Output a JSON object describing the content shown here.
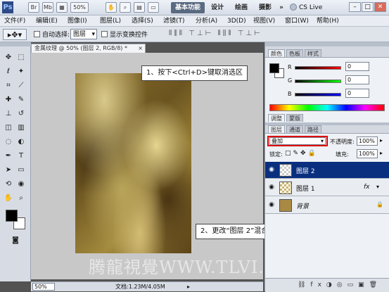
{
  "app": {
    "logo": "Ps",
    "br_label": "Br",
    "mb_label": "Mb",
    "zoom_display": "50%"
  },
  "workspaces": [
    "基本功能",
    "设计",
    "绘画",
    "摄影"
  ],
  "workspace_more": "»",
  "cs_live": "CS Live",
  "window_controls": {
    "minimize": "–",
    "maximize": "□",
    "close": "✕"
  },
  "menu": [
    "文件(F)",
    "编辑(E)",
    "图像(I)",
    "图层(L)",
    "选择(S)",
    "滤镜(T)",
    "分析(A)",
    "3D(D)",
    "视图(V)",
    "窗口(W)",
    "帮助(H)"
  ],
  "options": {
    "auto_select": "自动选择:",
    "layer_select": "图层",
    "show_transform": "显示变换控件"
  },
  "document": {
    "tab_title": "金属纹理 @ 50% (图层 2, RGB/8) *",
    "status_zoom": "50%",
    "status_doc": "文档:1.23M/4.05M"
  },
  "callouts": {
    "step1": "1、按下<Ctrl+D>键取消选区",
    "step2": "2、更改“图层 2”混合模式为“叠加”模式"
  },
  "watermark": "腾龍視覺WWW.TLVI.NET",
  "color_panel": {
    "tabs": [
      "颜色",
      "色板",
      "样式"
    ],
    "channels": [
      {
        "label": "R",
        "value": "0"
      },
      {
        "label": "G",
        "value": "0"
      },
      {
        "label": "B",
        "value": "0"
      }
    ]
  },
  "adjust_panel": {
    "tabs": [
      "调整",
      "蒙版"
    ]
  },
  "layers_panel": {
    "tabs": [
      "图层",
      "通道",
      "路径"
    ],
    "blend_mode": "叠加",
    "opacity_label": "不透明度:",
    "opacity_value": "100%",
    "lock_label": "锁定:",
    "fill_label": "填充:",
    "fill_value": "100%",
    "layers": [
      {
        "name": "图层 2",
        "selected": true,
        "fx": ""
      },
      {
        "name": "图层 1",
        "selected": false,
        "fx": "fx"
      },
      {
        "name": "背景",
        "selected": false,
        "fx": ""
      }
    ]
  },
  "colors": {
    "accent": "#0a2f7f",
    "highlight_box": "#e00000",
    "fg_swatch": "#000000",
    "bg_swatch": "#ffffff"
  }
}
